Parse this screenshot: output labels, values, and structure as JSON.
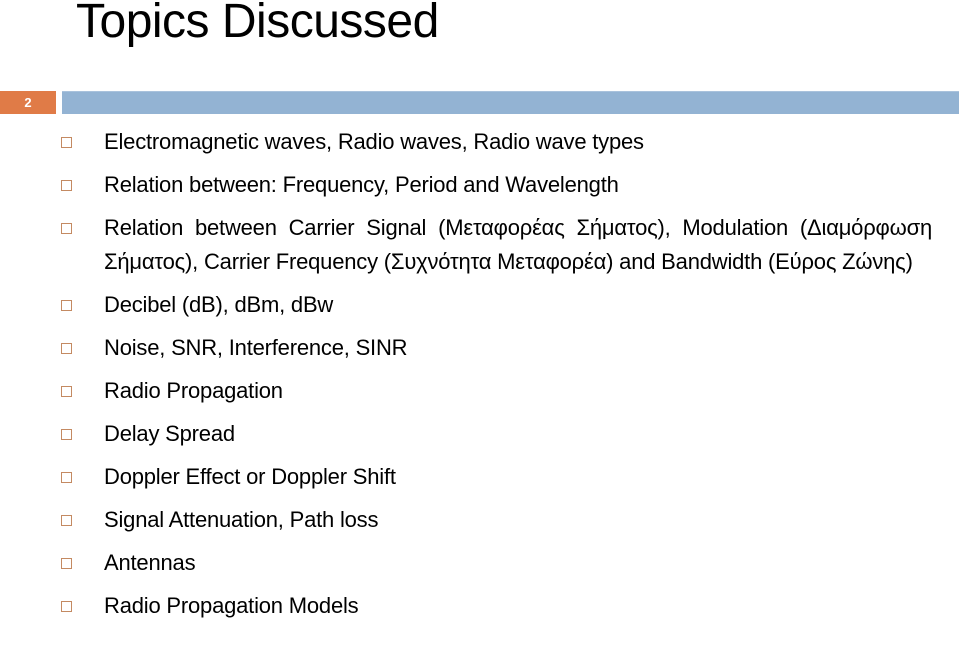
{
  "slide": {
    "title": "Topics Discussed",
    "page_number": "2",
    "colors": {
      "page_number_box": "#e07b47",
      "header_bar": "#93b3d3",
      "bullet": "#c48a62",
      "text": "#000000"
    }
  },
  "topics": [
    {
      "text": "Electromagnetic waves, Radio waves, Radio wave types",
      "bullet_icon": "hollow-square-bullet"
    },
    {
      "text": "Relation between: Frequency, Period and Wavelength",
      "bullet_icon": "hollow-square-bullet"
    },
    {
      "text": "Relation between Carrier Signal (Μεταφορέας Σήματος), Modulation (Διαμόρφωση Σήματος), Carrier Frequency (Συχνότητα Μεταφορέα) and Bandwidth (Εύρος Ζώνης)",
      "bullet_icon": "hollow-square-bullet"
    },
    {
      "text": "Decibel (dB), dBm, dBw",
      "bullet_icon": "hollow-square-bullet"
    },
    {
      "text": "Noise, SNR, Interference, SINR",
      "bullet_icon": "hollow-square-bullet"
    },
    {
      "text": "Radio Propagation",
      "bullet_icon": "hollow-square-bullet"
    },
    {
      "text": "Delay Spread",
      "bullet_icon": "hollow-square-bullet"
    },
    {
      "text": "Doppler Effect or Doppler Shift",
      "bullet_icon": "hollow-square-bullet"
    },
    {
      "text": "Signal Attenuation, Path loss",
      "bullet_icon": "hollow-square-bullet"
    },
    {
      "text": "Antennas",
      "bullet_icon": "hollow-square-bullet"
    },
    {
      "text": "Radio Propagation Models",
      "bullet_icon": "hollow-square-bullet"
    }
  ]
}
